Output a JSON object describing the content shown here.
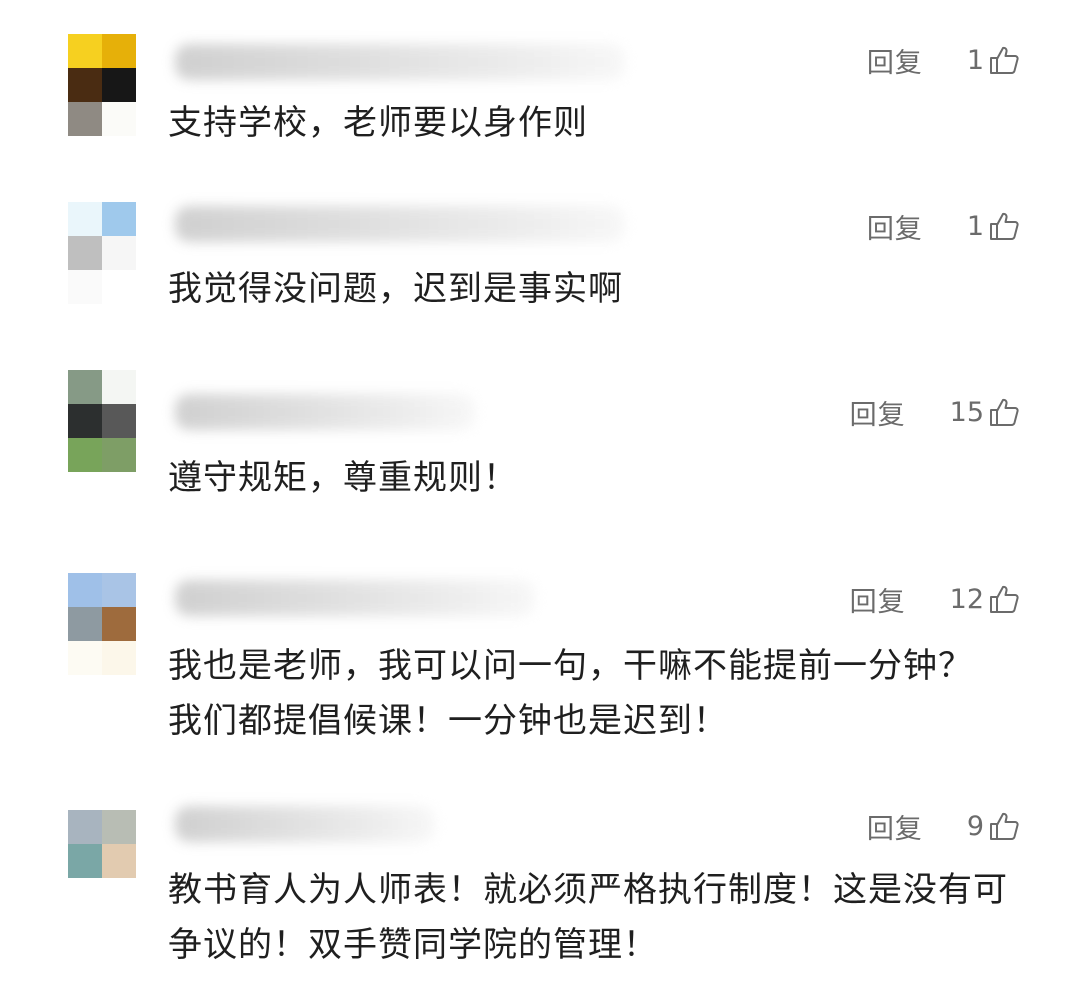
{
  "comments": [
    {
      "reply_label": "回复",
      "likes": "1",
      "text": "支持学校，老师要以身作则",
      "avatar_colors": [
        "#f6d020",
        "#e6b009",
        "#4a2c12",
        "#171717",
        "#8f8a83",
        "#fbfbf8"
      ]
    },
    {
      "reply_label": "回复",
      "likes": "1",
      "text": "我觉得没问题，迟到是事实啊",
      "avatar_colors": [
        "#eaf6fb",
        "#9fc9ec",
        "#bfbfbf",
        "#f6f6f6",
        "#fafafa",
        "#ffffff"
      ]
    },
    {
      "reply_label": "回复",
      "likes": "15",
      "text": "遵守规矩，尊重规则！",
      "avatar_colors": [
        "#869a86",
        "#f4f6f3",
        "#2c2f2f",
        "#585858",
        "#78a45a",
        "#7e9e66"
      ]
    },
    {
      "reply_label": "回复",
      "likes": "12",
      "text": "我也是老师，我可以问一句，干嘛不能提前一分钟？我们都提倡候课！一分钟也是迟到！",
      "avatar_colors": [
        "#9fc0e8",
        "#a9c4e6",
        "#8e9aa1",
        "#9e6b3d",
        "#fdfbf3",
        "#fcf7ea"
      ]
    },
    {
      "reply_label": "回复",
      "likes": "9",
      "text": "教书育人为人师表！就必须严格执行制度！这是没有可争议的！双手赞同学院的管理！",
      "avatar_colors": [
        "#a8b4bf",
        "#b8bdb4",
        "#7aa7a6",
        "#e2cbb0",
        "#ffffff",
        "#ffffff"
      ]
    }
  ]
}
